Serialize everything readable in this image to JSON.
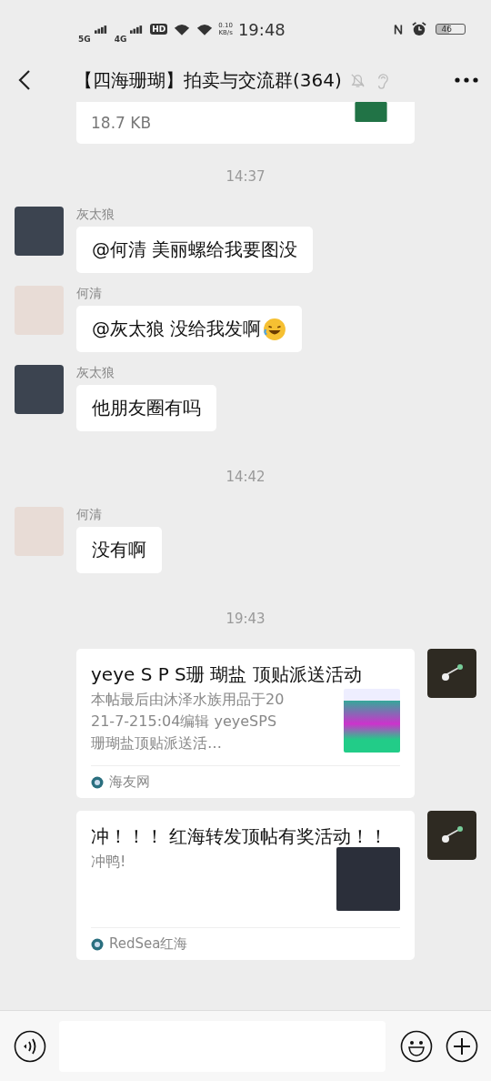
{
  "status_bar": {
    "network_1": "5G",
    "network_2": "4G",
    "hd": "HD",
    "speed": "0.10",
    "speed_unit": "KB/s",
    "time": "19:48",
    "battery": "46"
  },
  "header": {
    "title": "【四海珊瑚】拍卖与交流群(364)",
    "muted": true
  },
  "messages": [
    {
      "kind": "file",
      "size": "18.7 KB"
    },
    {
      "kind": "time",
      "text": "14:37"
    },
    {
      "kind": "text",
      "outgoing": false,
      "sender": "灰太狼",
      "color": "#3c4450",
      "text": "@何清  美丽螺给我要图没",
      "emoji_after": false
    },
    {
      "kind": "text",
      "outgoing": false,
      "sender": "何清",
      "color": "#e8dcd6",
      "text": "@灰太狼  没给我发啊",
      "emoji_after": true
    },
    {
      "kind": "text",
      "outgoing": false,
      "sender": "灰太狼",
      "color": "#3c4450",
      "text": "他朋友圈有吗",
      "emoji_after": false
    },
    {
      "kind": "time",
      "text": "14:42"
    },
    {
      "kind": "text",
      "outgoing": false,
      "sender": "何清",
      "color": "#e8dcd6",
      "text": "没有啊",
      "emoji_after": false
    },
    {
      "kind": "time",
      "text": "19:43"
    },
    {
      "kind": "link",
      "outgoing": true,
      "title": "yeye S P S珊 瑚盐 顶贴派送活动",
      "description": "本帖最后由沐泽水族用品于2021-7-215:04编辑 yeyeSPS珊瑚盐顶贴派送活…",
      "thumbnail": {
        "kind": "bucket"
      },
      "source": "海友网"
    },
    {
      "kind": "link",
      "outgoing": true,
      "title": "冲！！！ 红海转发顶帖有奖活动！！",
      "description": "冲鸭!",
      "thumbnail": {
        "kind": "dark"
      },
      "source": "RedSea红海"
    }
  ]
}
